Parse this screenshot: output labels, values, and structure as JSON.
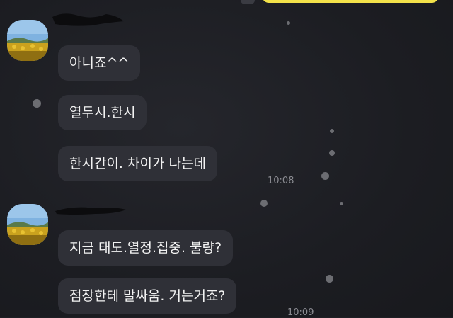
{
  "chat": {
    "groups": [
      {
        "messages": [
          "아니죠^^",
          "열두시.한시",
          "한시간이. 차이가 나는데"
        ],
        "time": "10:08"
      },
      {
        "messages": [
          "지금 태도.열정.집중. 불량?",
          "점장한테 말싸움. 거는거죠?"
        ],
        "time": "10:09"
      }
    ]
  },
  "colors": {
    "background": "#1e1f24",
    "bubble": "#2f3037",
    "text": "#f2f2f2",
    "own_bubble": "#f3e24a",
    "time": "#8a8b91"
  },
  "icons": {
    "avatar": "sunflower-field-avatar"
  }
}
